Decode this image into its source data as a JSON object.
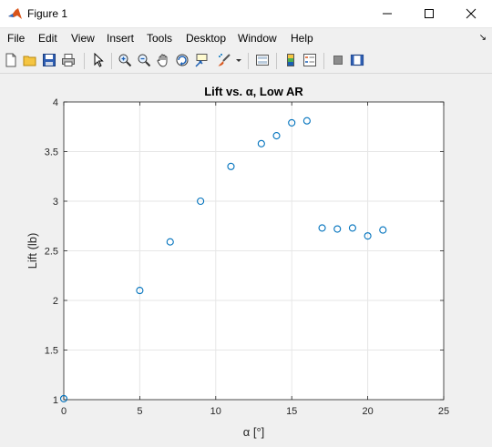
{
  "window": {
    "title": "Figure 1",
    "controls": {
      "minimize": "minimize",
      "maximize": "maximize",
      "close": "close"
    }
  },
  "menu": {
    "items": [
      "File",
      "Edit",
      "View",
      "Insert",
      "Tools",
      "Desktop",
      "Window",
      "Help"
    ],
    "overflow_glyph": "↘"
  },
  "toolbar": {
    "icons": [
      "new-figure-icon",
      "open-file-icon",
      "save-icon",
      "print-icon",
      "pointer-icon",
      "zoom-in-icon",
      "zoom-out-icon",
      "pan-icon",
      "rotate-3d-icon",
      "data-cursor-icon",
      "brush-icon",
      "link-plot-icon",
      "colorbar-icon",
      "legend-icon",
      "hide-plot-tools-icon",
      "show-plot-tools-icon"
    ]
  },
  "chart_data": {
    "type": "scatter",
    "title": "Lift vs. α, Low AR",
    "xlabel": "α [°]",
    "ylabel": "Lift (lb)",
    "xlim": [
      0,
      25
    ],
    "ylim": [
      1,
      4
    ],
    "xticks": [
      0,
      5,
      10,
      15,
      20,
      25
    ],
    "yticks": [
      1,
      1.5,
      2,
      2.5,
      3,
      3.5,
      4
    ],
    "grid": true,
    "marker_color": "#0072bd",
    "x": [
      0,
      5,
      7,
      9,
      11,
      13,
      14,
      15,
      16,
      17,
      18,
      19,
      20,
      21
    ],
    "y": [
      1.01,
      2.1,
      2.59,
      3.0,
      3.35,
      3.58,
      3.66,
      3.79,
      3.81,
      2.73,
      2.72,
      2.73,
      2.65,
      2.71
    ]
  }
}
